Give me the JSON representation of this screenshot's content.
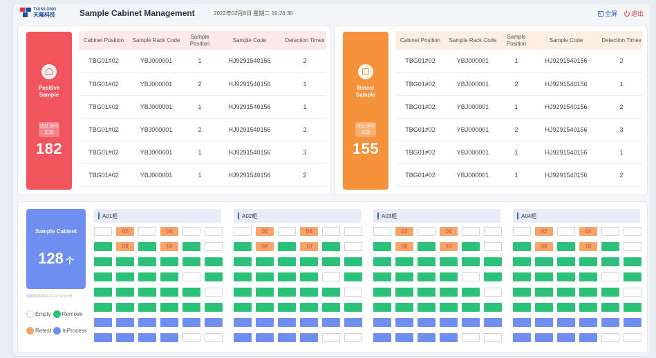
{
  "header": {
    "logo_en": "TIANLONG",
    "logo_cn": "天隆科技",
    "title": "Sample Cabinet Management",
    "datetime": "2022年02月8日  星期二  15:24:30",
    "fullscreen_label": "全屏",
    "exit_label": "退出"
  },
  "columns": [
    "Cabinet Position",
    "Sample Rack Code",
    "Sample Position",
    "Sample Code",
    "Detection Times"
  ],
  "positive": {
    "title": "Positive Sample",
    "pending_label": "待处理样本数",
    "count": "182",
    "rows": [
      [
        "TBG01#02",
        "YBJ000001",
        "1",
        "HJ9291540156",
        "2"
      ],
      [
        "TBG01#02",
        "YBJ000001",
        "2",
        "HJ9291540156",
        "1"
      ],
      [
        "TBG01#02",
        "YBJ000001",
        "1",
        "HJ9291540156",
        "1"
      ],
      [
        "TBG01#02",
        "YBJ000001",
        "2",
        "HJ9291540156",
        "2"
      ],
      [
        "TBG01#02",
        "YBJ000001",
        "1",
        "HJ9291540156",
        "3"
      ],
      [
        "TBG01#02",
        "YBJ000001",
        "1",
        "HJ9291540156",
        "2"
      ]
    ]
  },
  "retest": {
    "title": "Retest Sample",
    "pending_label": "待处理样本数",
    "count": "155",
    "rows": [
      [
        "TBG01#02",
        "YBJ000001",
        "1",
        "HJ9291540156",
        "2"
      ],
      [
        "TBG01#02",
        "YBJ000001",
        "2",
        "HJ9291540156",
        "1"
      ],
      [
        "TBG01#02",
        "YBJ000001",
        "1",
        "HJ9291540156",
        "2"
      ],
      [
        "TBG01#02",
        "YBJ000001",
        "2",
        "HJ9291540156",
        "3"
      ],
      [
        "TBG01#02",
        "YBJ000001",
        "1",
        "HJ9291540156",
        "1"
      ],
      [
        "TBG01#02",
        "YBJ000001",
        "1",
        "HJ9291540156",
        "2"
      ]
    ]
  },
  "cabinet_summary": {
    "title": "Sample Cabinet",
    "count": "128",
    "unit": "个",
    "updated": "更新时间2022-02-24 10:30:58"
  },
  "legend": {
    "empty": "Empty",
    "remove": "Remove",
    "retest": "Retest",
    "inprocess": "InProcess"
  },
  "colors": {
    "positive": "#f1545a",
    "retest": "#f6913c",
    "cabinet": "#6f8ff0",
    "remove": "#2cc178",
    "retest_slot": "#f5a46a",
    "empty_border": "#cfd4dc"
  },
  "cabinets": [
    {
      "name": "A01柜"
    },
    {
      "name": "A02柜"
    },
    {
      "name": "A03柜"
    },
    {
      "name": "A04柜"
    }
  ],
  "slot_grid": [
    [
      {
        "s": "e"
      },
      {
        "s": "o",
        "t": "02"
      },
      {
        "s": "e"
      },
      {
        "s": "o",
        "t": "04"
      },
      {
        "s": "e"
      },
      {
        "s": "e"
      }
    ],
    [
      {
        "s": "g"
      },
      {
        "s": "o",
        "t": "08"
      },
      {
        "s": "g"
      },
      {
        "s": "o",
        "t": "10"
      },
      {
        "s": "g"
      },
      {
        "s": "e"
      }
    ],
    [
      {
        "s": "g"
      },
      {
        "s": "g"
      },
      {
        "s": "g"
      },
      {
        "s": "g"
      },
      {
        "s": "g"
      },
      {
        "s": "g"
      }
    ],
    [
      {
        "s": "g"
      },
      {
        "s": "g"
      },
      {
        "s": "g"
      },
      {
        "s": "g"
      },
      {
        "s": "e"
      },
      {
        "s": "g"
      }
    ],
    [
      {
        "s": "g"
      },
      {
        "s": "g"
      },
      {
        "s": "g"
      },
      {
        "s": "g"
      },
      {
        "s": "g"
      },
      {
        "s": "e"
      }
    ],
    [
      {
        "s": "g"
      },
      {
        "s": "g"
      },
      {
        "s": "g"
      },
      {
        "s": "g"
      },
      {
        "s": "g"
      },
      {
        "s": "g"
      }
    ],
    [
      {
        "s": "b"
      },
      {
        "s": "b"
      },
      {
        "s": "b"
      },
      {
        "s": "b"
      },
      {
        "s": "b"
      },
      {
        "s": "b"
      }
    ],
    [
      {
        "s": "b"
      },
      {
        "s": "b"
      },
      {
        "s": "b"
      },
      {
        "s": "b"
      },
      {
        "s": "e"
      },
      {
        "s": "e"
      }
    ]
  ]
}
